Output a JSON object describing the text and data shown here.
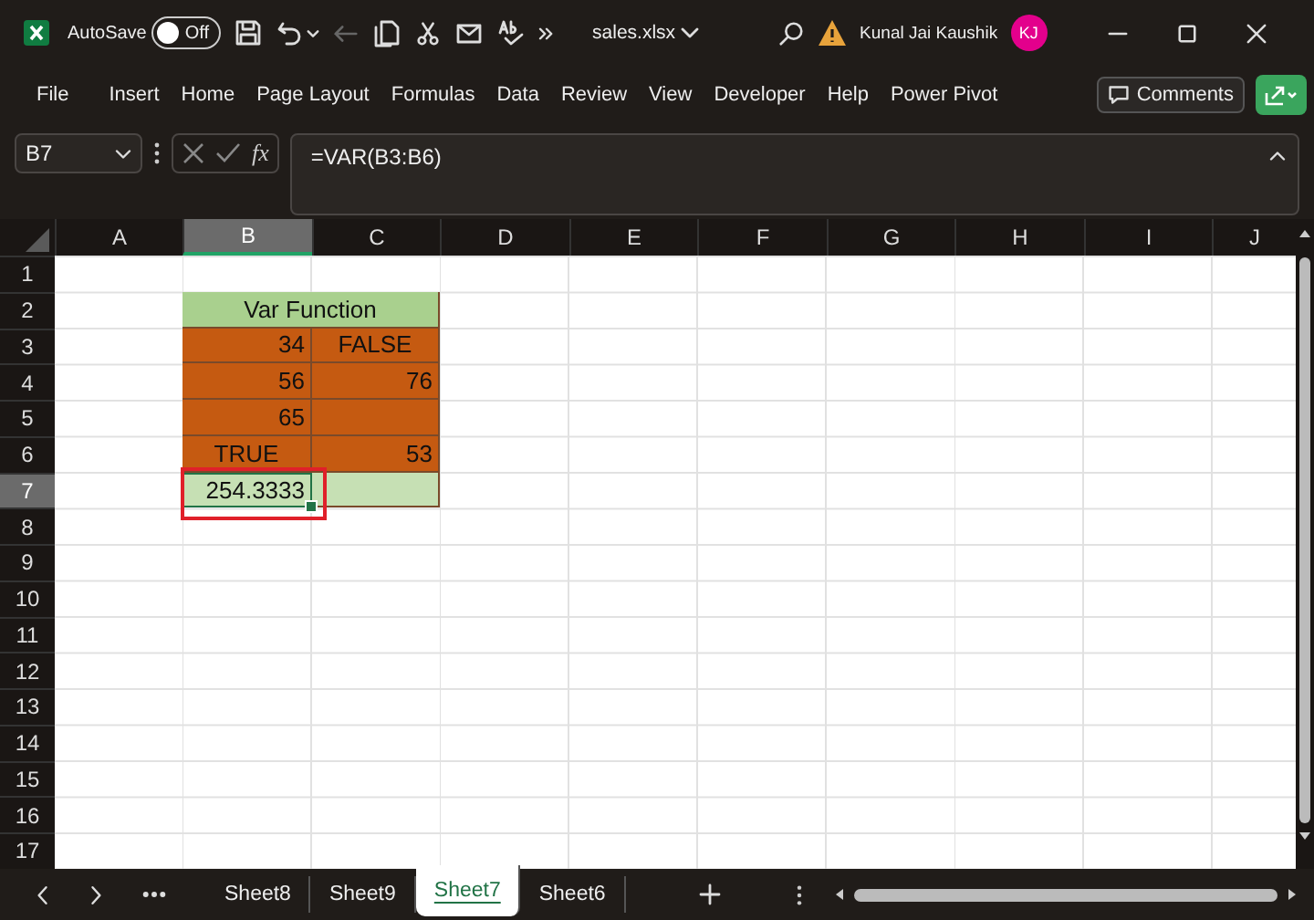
{
  "title_bar": {
    "autosave_label": "AutoSave",
    "autosave": {
      "on": false,
      "label": "Off"
    },
    "redo_disabled": true,
    "file_name": "sales.xlsx",
    "user_name": "Kunal Jai Kaushik",
    "avatar_initials": "KJ"
  },
  "menu": {
    "items": [
      "File",
      "Insert",
      "Home",
      "Page Layout",
      "Formulas",
      "Data",
      "Review",
      "View",
      "Developer",
      "Help",
      "Power Pivot"
    ],
    "comments_button": "Comments"
  },
  "formula_bar": {
    "name_box": "B7",
    "function_label": "fx",
    "formula": "=VAR(B3:B6)"
  },
  "sheet": {
    "columns": [
      {
        "label": "A",
        "selected": false
      },
      {
        "label": "B",
        "selected": true
      },
      {
        "label": "C",
        "selected": false
      },
      {
        "label": "D",
        "selected": false
      },
      {
        "label": "E",
        "selected": false
      },
      {
        "label": "F",
        "selected": false
      },
      {
        "label": "G",
        "selected": false
      },
      {
        "label": "H",
        "selected": false
      },
      {
        "label": "I",
        "selected": false
      },
      {
        "label": "J",
        "selected": false
      }
    ],
    "rows": [
      {
        "number": "1",
        "selected": false
      },
      {
        "number": "2",
        "selected": false
      },
      {
        "number": "3",
        "selected": false
      },
      {
        "number": "4",
        "selected": false
      },
      {
        "number": "5",
        "selected": false
      },
      {
        "number": "6",
        "selected": false
      },
      {
        "number": "7",
        "selected": true
      },
      {
        "number": "8",
        "selected": false
      },
      {
        "number": "9",
        "selected": false
      },
      {
        "number": "10",
        "selected": false
      },
      {
        "number": "11",
        "selected": false
      },
      {
        "number": "12",
        "selected": false
      },
      {
        "number": "13",
        "selected": false
      },
      {
        "number": "14",
        "selected": false
      },
      {
        "number": "15",
        "selected": false
      },
      {
        "number": "16",
        "selected": false
      },
      {
        "number": "17",
        "selected": false
      }
    ],
    "table": {
      "title": {
        "text": "Var Function",
        "color": "#a9d08e"
      },
      "rows": [
        {
          "cells": [
            {
              "kind": "number",
              "text": "34",
              "color": "#c55a11"
            },
            {
              "kind": "boolean",
              "text": "FALSE",
              "color": "#c55a11"
            }
          ]
        },
        {
          "cells": [
            {
              "kind": "number",
              "text": "56",
              "color": "#c55a11"
            },
            {
              "kind": "number",
              "text": "76",
              "color": "#c55a11"
            }
          ]
        },
        {
          "cells": [
            {
              "kind": "number",
              "text": "65",
              "color": "#c55a11"
            },
            {
              "kind": "number",
              "color": "#c55a11"
            }
          ]
        },
        {
          "cells": [
            {
              "kind": "boolean",
              "text": "TRUE",
              "color": "#c55a11"
            },
            {
              "kind": "number",
              "text": "53",
              "color": "#c55a11"
            }
          ]
        },
        {
          "cells": [
            {
              "kind": "number",
              "text": "254.3333",
              "color": "#c6e0b4",
              "selected": true
            },
            {
              "kind": "number",
              "color": "#c6e0b4",
              "selected": false
            }
          ]
        }
      ]
    }
  },
  "sheet_tabs": [
    {
      "label": "Sheet8",
      "selected": false
    },
    {
      "label": "Sheet9",
      "selected": false
    },
    {
      "label": "Sheet7",
      "selected": true
    },
    {
      "label": "Sheet6",
      "selected": false
    }
  ]
}
